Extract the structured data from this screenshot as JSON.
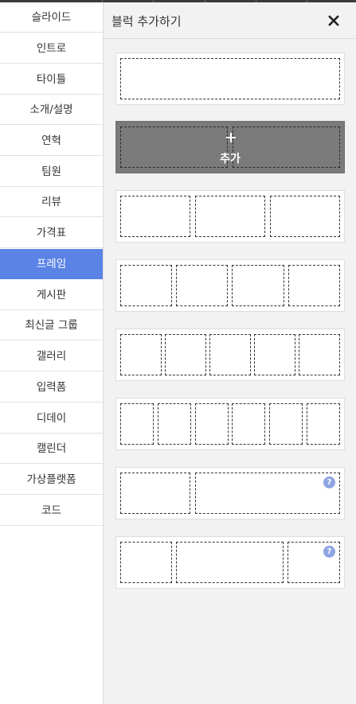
{
  "sidebar": {
    "items": [
      {
        "label": "슬라이드",
        "active": false
      },
      {
        "label": "인트로",
        "active": false
      },
      {
        "label": "타이틀",
        "active": false
      },
      {
        "label": "소개/설명",
        "active": false
      },
      {
        "label": "연혁",
        "active": false
      },
      {
        "label": "팀원",
        "active": false
      },
      {
        "label": "리뷰",
        "active": false
      },
      {
        "label": "가격표",
        "active": false
      },
      {
        "label": "프레임",
        "active": true
      },
      {
        "label": "게시판",
        "active": false
      },
      {
        "label": "최신글 그룹",
        "active": false
      },
      {
        "label": "갤러리",
        "active": false
      },
      {
        "label": "입력폼",
        "active": false
      },
      {
        "label": "디데이",
        "active": false
      },
      {
        "label": "캘린더",
        "active": false
      },
      {
        "label": "가상플랫폼",
        "active": false
      },
      {
        "label": "코드",
        "active": false
      }
    ]
  },
  "panel": {
    "title": "블럭 추가하기",
    "close_icon": "close-icon",
    "hover_add_label": "추가",
    "help_glyph": "?",
    "blocks": [
      {
        "name": "frame-1-column",
        "columns": 1
      },
      {
        "name": "frame-2-columns",
        "columns": 2,
        "hovered": true
      },
      {
        "name": "frame-3-columns",
        "columns": 3
      },
      {
        "name": "frame-4-columns",
        "columns": 4
      },
      {
        "name": "frame-5-columns",
        "columns": 5
      },
      {
        "name": "frame-6-columns",
        "columns": 6
      },
      {
        "name": "frame-1-2-columns",
        "columns": 2,
        "has_help": true
      },
      {
        "name": "frame-1-2-1-columns",
        "columns": 3,
        "has_help": true
      }
    ]
  },
  "colors": {
    "accent": "#5b83e6",
    "hover_block": "#7a7a7a",
    "help_icon": "#8da5e3",
    "panel_bg": "#f2f2f2"
  }
}
